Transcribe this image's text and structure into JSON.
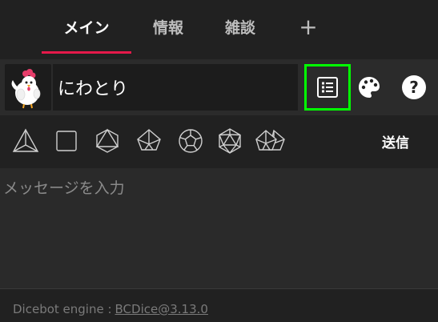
{
  "tabs": [
    {
      "label": "メイン",
      "active": true
    },
    {
      "label": "情報",
      "active": false
    },
    {
      "label": "雑談",
      "active": false
    }
  ],
  "tab_add_symbol": "+",
  "colors": {
    "accent": "#e5194a",
    "highlight": "#00ff00",
    "background": "#212121"
  },
  "character": {
    "name": "にわとり",
    "avatar_icon": "chicken-avatar"
  },
  "toolbar_icons": [
    "list-icon",
    "palette-icon",
    "help-icon"
  ],
  "dice": [
    "d4",
    "d6",
    "d8",
    "d10",
    "d12",
    "d20",
    "d100"
  ],
  "send_label": "送信",
  "message": {
    "placeholder": "メッセージを入力",
    "value": ""
  },
  "footer": {
    "prefix": "Dicebot engine :",
    "link": "BCDice@3.13.0"
  }
}
